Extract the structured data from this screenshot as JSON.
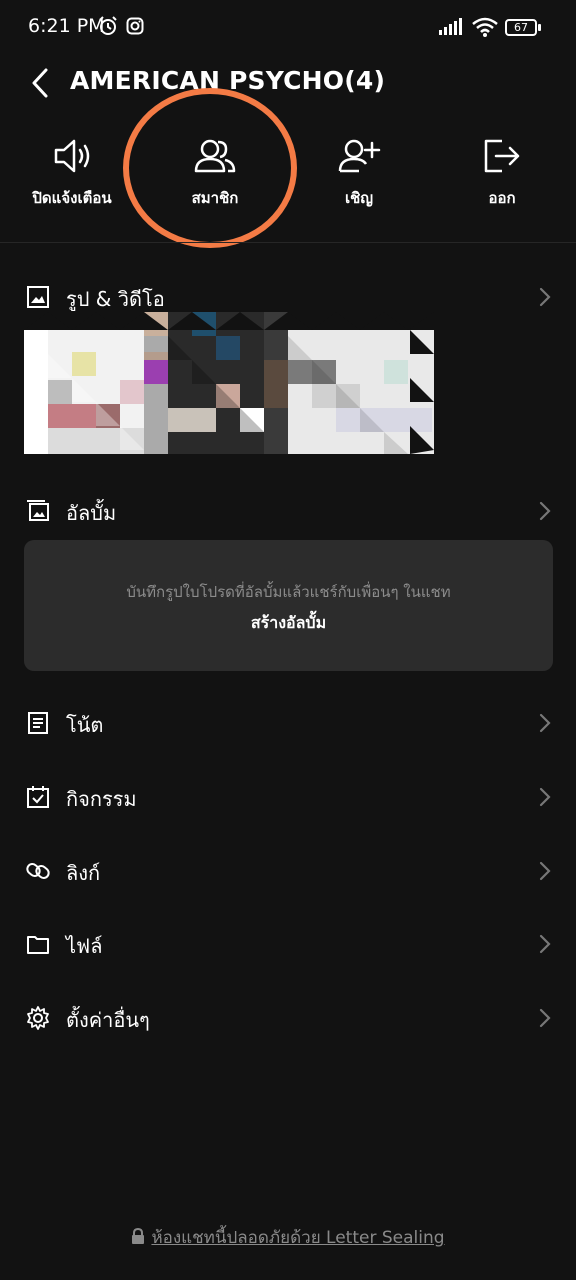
{
  "status": {
    "time": "6:21 PM",
    "battery": "67",
    "icons": [
      "alarm-icon",
      "instagram-icon",
      "signal-icon",
      "wifi-icon",
      "battery-icon"
    ]
  },
  "header": {
    "title": "AMERICAN PSYCHO(4)",
    "back_icon": "back-arrow-icon"
  },
  "actions": [
    {
      "label": "ปิดแจ้งเตือน",
      "icon": "speaker-icon"
    },
    {
      "label": "สมาชิก",
      "icon": "members-icon"
    },
    {
      "label": "เชิญ",
      "icon": "add-friend-icon"
    },
    {
      "label": "ออก",
      "icon": "leave-icon"
    }
  ],
  "annotation_color": "#f47b45",
  "sections": {
    "media": {
      "label": "รูป & วิดีโอ",
      "icon": "image-icon"
    },
    "album": {
      "label": "อัลบั้ม",
      "icon": "album-icon"
    },
    "note": {
      "label": "โน้ต",
      "icon": "note-icon"
    },
    "events": {
      "label": "กิจกรรม",
      "icon": "calendar-icon"
    },
    "links": {
      "label": "ลิงก์",
      "icon": "link-icon"
    },
    "files": {
      "label": "ไฟล์",
      "icon": "folder-icon"
    },
    "settings": {
      "label": "ตั้งค่าอื่นๆ",
      "icon": "gear-icon"
    }
  },
  "album_card": {
    "hint": "บันทึกรูปใบโปรดที่อัลบั้มแล้วแชร์กับเพื่อนๆ ในแชท",
    "create_label": "สร้างอัลบั้ม"
  },
  "footer": {
    "text": "ห้องแชทนี้ปลอดภัยด้วย Letter Sealing",
    "icon": "lock-icon"
  }
}
